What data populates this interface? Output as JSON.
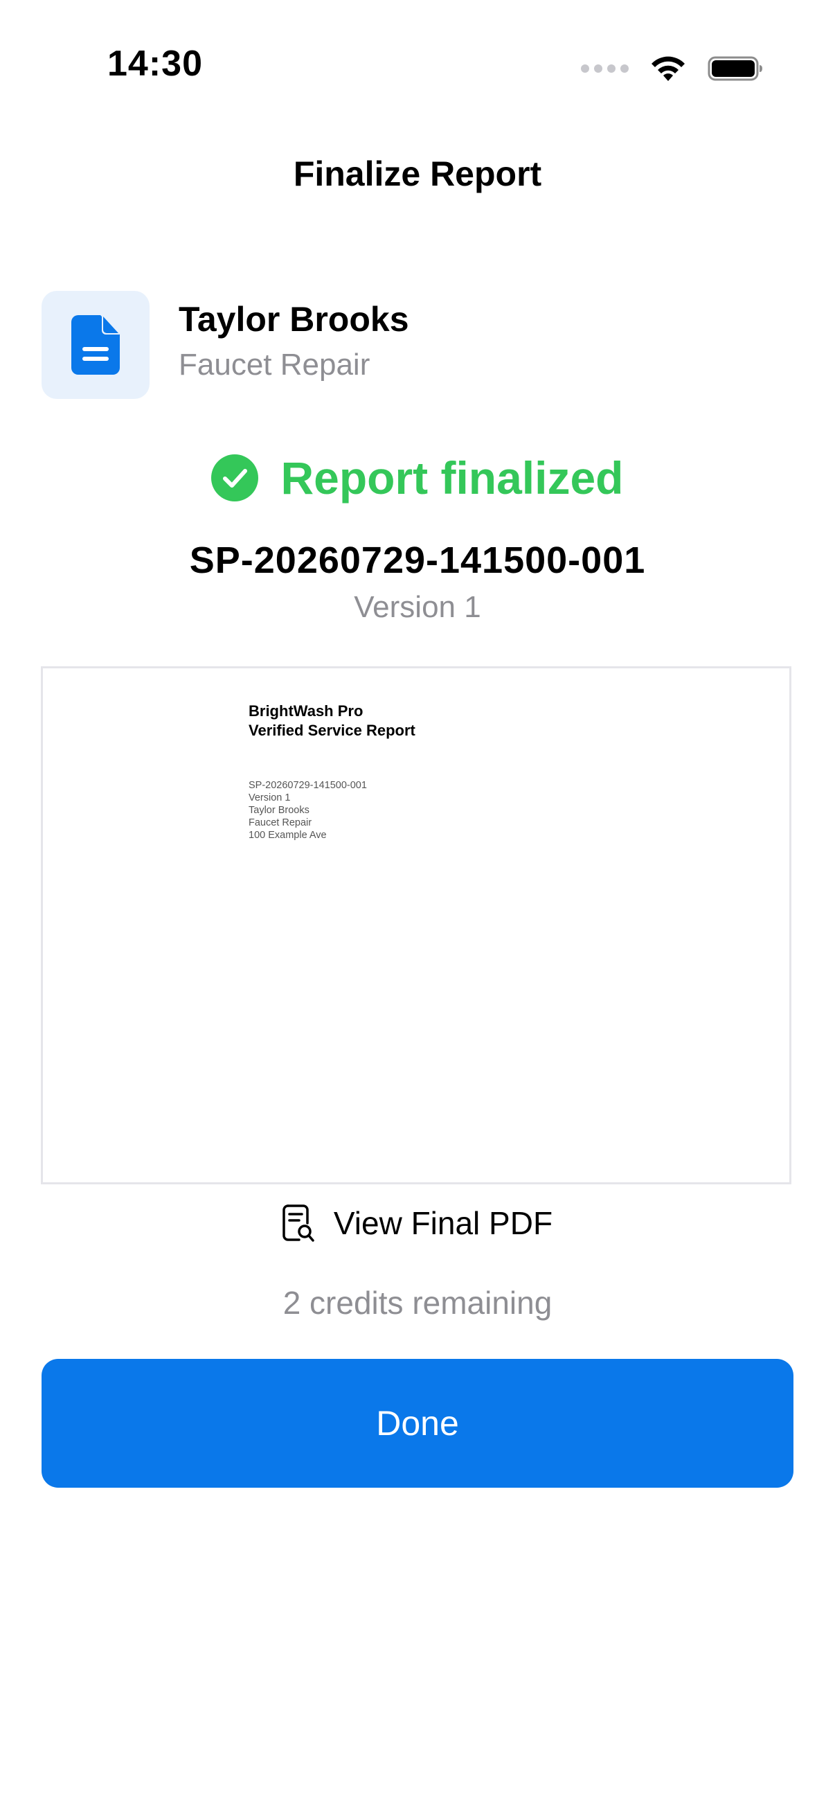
{
  "status_bar": {
    "time": "14:30",
    "icons": [
      "signal-icon",
      "wifi-icon",
      "battery-icon"
    ]
  },
  "nav": {
    "title": "Finalize Report"
  },
  "job": {
    "customer_name": "Taylor Brooks",
    "service_type": "Faucet Repair",
    "icon": "document-icon"
  },
  "finalized": {
    "status_text": "Report finalized",
    "icon": "checkmark-circle-icon",
    "report_id": "SP-20260729-141500-001",
    "version": "Version 1"
  },
  "pdf_preview": {
    "company": "BrightWash Pro",
    "document_title": "Verified Service Report",
    "lines": [
      "SP-20260729-141500-001",
      "Version 1",
      "Taylor Brooks",
      "Faucet Repair",
      "100 Example Ave"
    ]
  },
  "actions": {
    "view_pdf_label": "View Final PDF",
    "view_pdf_icon": "document-search-icon",
    "credits_text": "2 credits remaining",
    "done_label": "Done"
  },
  "colors": {
    "accent": "#0A78EA",
    "success": "#34C759",
    "secondary_text": "#8E8E93",
    "tile_background": "#E8F1FC"
  }
}
